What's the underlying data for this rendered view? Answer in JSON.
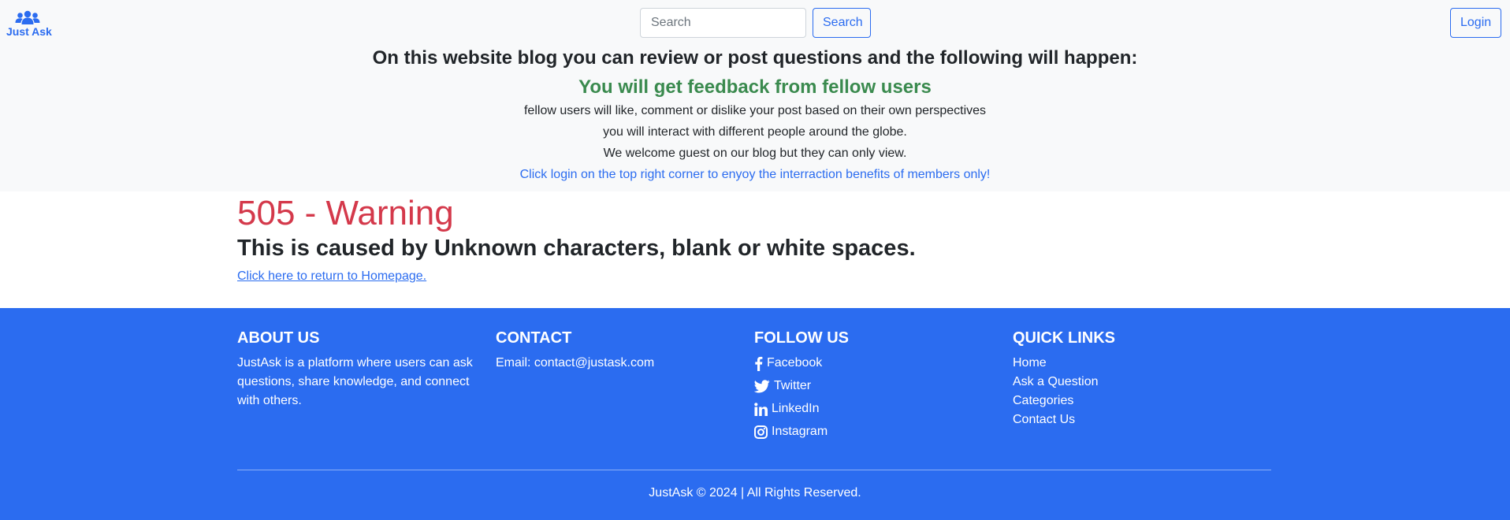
{
  "header": {
    "logo_text": "Just Ask",
    "search_placeholder": "Search",
    "search_button": "Search",
    "login_button": "Login"
  },
  "intro": {
    "heading": "On this website blog you can review or post questions and the following will happen:",
    "subheading": "You will get feedback from fellow users",
    "lines": [
      "fellow users will like, comment or dislike your post based on their own perspectives",
      "you will interact with different people around the globe.",
      "We welcome guest on our blog but they can only view."
    ],
    "cta": "Click login on the top right corner to enyoy the interraction benefits of members only!"
  },
  "main": {
    "title": "505 - Warning",
    "subtitle": "This is caused by Unknown characters, blank or white spaces.",
    "home_link": "Click here to return to Homepage."
  },
  "footer": {
    "about": {
      "title": "ABOUT US",
      "text": "JustAsk is a platform where users can ask questions, share knowledge, and connect with others."
    },
    "contact": {
      "title": "CONTACT",
      "email": "Email: contact@justask.com"
    },
    "follow": {
      "title": "FOLLOW US",
      "items": [
        {
          "label": "Facebook",
          "icon": "facebook-icon"
        },
        {
          "label": "Twitter",
          "icon": "twitter-icon"
        },
        {
          "label": "LinkedIn",
          "icon": "linkedin-icon"
        },
        {
          "label": "Instagram",
          "icon": "instagram-icon"
        }
      ]
    },
    "quick_links": {
      "title": "QUICK LINKS",
      "items": [
        "Home",
        "Ask a Question",
        "Categories",
        "Contact Us"
      ]
    },
    "copyright": "JustAsk © 2024 | All Rights Reserved."
  },
  "colors": {
    "primary": "#2b6cf0",
    "success": "#3a8a4e",
    "danger": "#d4394b",
    "header_bg": "#f8f9fa"
  }
}
